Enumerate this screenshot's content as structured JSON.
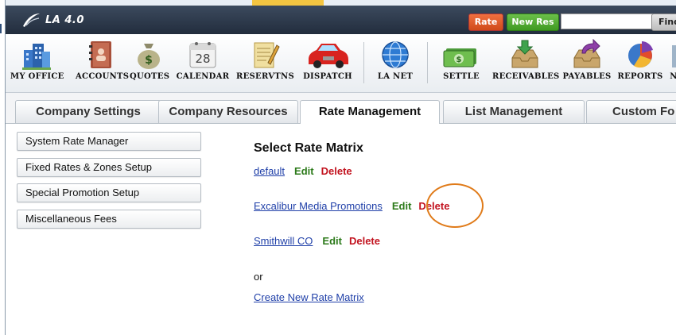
{
  "app": {
    "title": "LA 4.0"
  },
  "header": {
    "rate_label": "Rate",
    "new_res_label": "New Res",
    "search_value": "",
    "find_label": "Find"
  },
  "toolbar": {
    "items": [
      {
        "label": "MY OFFICE",
        "icon": "office-buildings-icon"
      },
      {
        "label": "ACCOUNTS",
        "icon": "address-book-icon"
      },
      {
        "label": "QUOTES",
        "icon": "money-bag-icon"
      },
      {
        "label": "CALENDAR",
        "icon": "calendar-icon",
        "day": "28"
      },
      {
        "label": "RESERVTNS",
        "icon": "notepad-pencil-icon"
      },
      {
        "label": "DISPATCH",
        "icon": "red-car-icon"
      },
      {
        "label": "LA NET",
        "icon": "globe-icon"
      },
      {
        "label": "SETTLE",
        "icon": "cash-icon"
      },
      {
        "label": "RECEIVABLES",
        "icon": "inbox-tray-icon"
      },
      {
        "label": "PAYABLES",
        "icon": "outbox-tray-icon"
      },
      {
        "label": "REPORTS",
        "icon": "pie-chart-icon"
      },
      {
        "label": "N",
        "icon": "more-icon"
      }
    ]
  },
  "tabs": [
    {
      "label": "Company Settings",
      "active": false
    },
    {
      "label": "Company Resources",
      "active": false
    },
    {
      "label": "Rate Management",
      "active": true
    },
    {
      "label": "List Management",
      "active": false
    },
    {
      "label": "Custom Fo",
      "active": false
    }
  ],
  "sidebar": {
    "items": [
      {
        "label": "System Rate Manager"
      },
      {
        "label": "Fixed Rates & Zones Setup"
      },
      {
        "label": "Special Promotion Setup"
      },
      {
        "label": "Miscellaneous Fees"
      }
    ]
  },
  "main": {
    "title": "Select Rate Matrix",
    "matrices": [
      {
        "name": "default",
        "edit": "Edit",
        "delete": "Delete"
      },
      {
        "name": "Excalibur Media Promotions",
        "edit": "Edit",
        "delete": "Delete"
      },
      {
        "name": "Smithwill CO",
        "edit": "Edit",
        "delete": "Delete"
      }
    ],
    "or_text": "or",
    "create_label": "Create New Rate Matrix"
  },
  "colors": {
    "header_bg": "#2b3648",
    "rate_btn": "#e05a28",
    "new_res_btn": "#52ad30",
    "link": "#1f3fa8",
    "edit": "#2c7a1a",
    "delete": "#c2131f",
    "highlight_circle": "#e07b1a"
  }
}
